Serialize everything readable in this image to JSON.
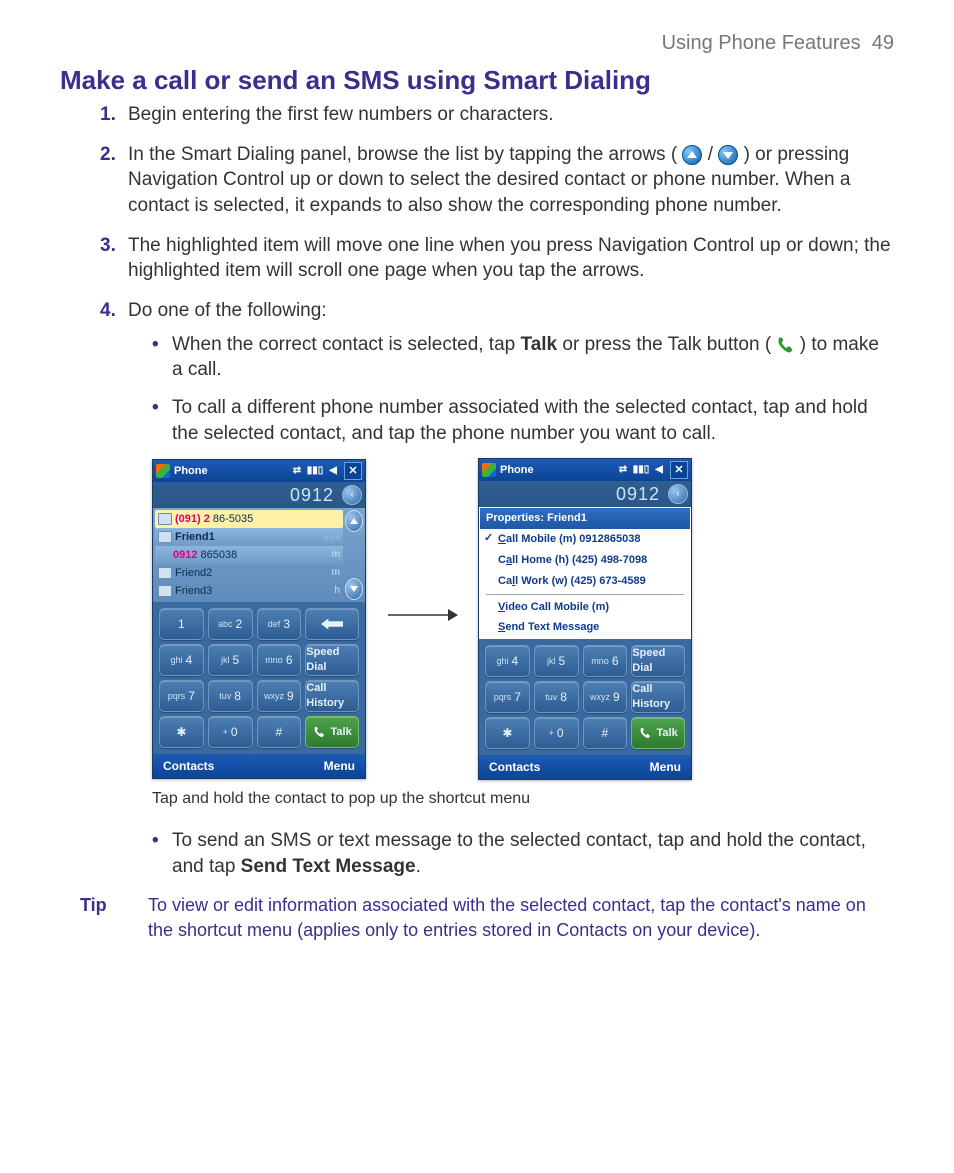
{
  "header": {
    "section": "Using Phone Features",
    "page": "49"
  },
  "title": "Make a call or send an SMS using Smart Dialing",
  "steps": {
    "s1": {
      "num": "1.",
      "text": "Begin entering the first few numbers or characters."
    },
    "s2": {
      "num": "2.",
      "t1": "In the Smart Dialing panel, browse the list by tapping the arrows (",
      "t2": " / ",
      "t3": " ) or pressing Navigation Control up or down to select the desired contact or phone number. When a contact is selected, it expands to also show the corresponding phone number."
    },
    "s3": {
      "num": "3.",
      "text": "The highlighted item will move one line when you press Navigation Control up or down; the highlighted item will scroll one page when you tap the arrows."
    },
    "s4": {
      "num": "4.",
      "text": "Do one of the following:"
    }
  },
  "bullets": {
    "b1": {
      "t1": "When the correct contact is selected, tap ",
      "talk": "Talk",
      "t2": " or press the Talk button ( ",
      "t3": " ) to make a call."
    },
    "b2": "To call a different phone number associated with the selected contact, tap and hold the selected contact, and tap the phone number you want to call.",
    "b3": {
      "t1": "To send an SMS or text message to the selected contact, tap and hold the contact, and tap ",
      "bold": "Send Text Message",
      "t2": "."
    }
  },
  "caption": "Tap and hold the contact to pop up the shortcut menu",
  "tip": {
    "label": "Tip",
    "body": "To view or edit information associated with the selected contact, tap the contact's name on the shortcut menu (applies only to entries stored in Contacts on your device)."
  },
  "phone": {
    "title": "Phone",
    "display": "0912",
    "status_icons": {
      "sync": "⇄",
      "signal": "▮▮▯",
      "speaker": "◀"
    },
    "close": "✕",
    "list_left": {
      "r0": {
        "prefix": "(091) 2",
        "rest": "86-5035"
      },
      "r1": {
        "name": "Friend1"
      },
      "r2": {
        "num_hi": "0912",
        "num_rest": "865038",
        "suffix": "m"
      },
      "r3": {
        "name": "Friend2",
        "suffix": "m"
      },
      "r4": {
        "name": "Friend3",
        "suffix": "h"
      }
    },
    "popup": {
      "title": "Properties: Friend1",
      "i1": {
        "u": "C",
        "rest": "all Mobile (m) 0912865038"
      },
      "i2": {
        "u": "a",
        "pre": "C",
        "rest": "ll Home (h) (425) 498-7098"
      },
      "i3": {
        "u": "l",
        "pre": "Ca",
        "rest": "l Work (w) (425) 673-4589"
      },
      "i4": {
        "u": "V",
        "rest": "ideo Call Mobile (m)"
      },
      "i5": {
        "u": "S",
        "rest": "end Text Message"
      }
    },
    "keys": {
      "k1": "1",
      "k2s": "abc",
      "k2": "2",
      "k3s": "def",
      "k3": "3",
      "k4s": "ghi",
      "k4": "4",
      "k5s": "jkl",
      "k5": "5",
      "k6s": "mno",
      "k6": "6",
      "k7s": "pqrs",
      "k7": "7",
      "k8s": "tuv",
      "k8": "8",
      "k9s": "wxyz",
      "k9": "9",
      "star": "✱",
      "k0s": "+",
      "k0": "0",
      "hash": "#",
      "speed": "Speed Dial",
      "history": "Call History",
      "talk": "Talk"
    },
    "soft": {
      "left": "Contacts",
      "right": "Menu"
    }
  }
}
